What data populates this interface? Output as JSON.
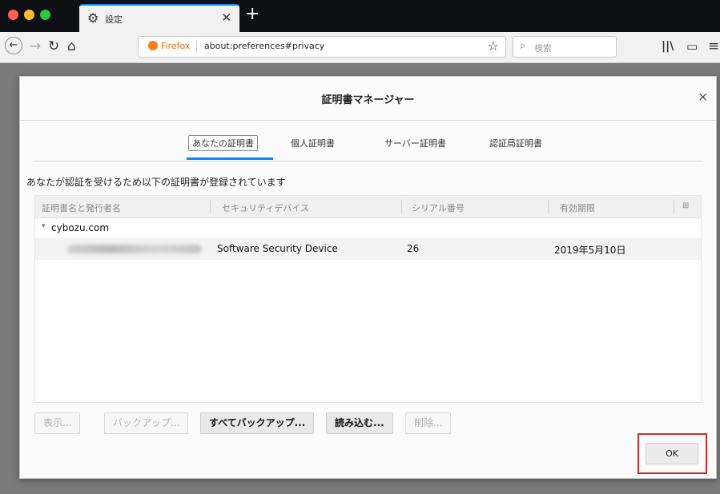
{
  "browser": {
    "tab_title": "設定",
    "url_brand": "Firefox",
    "url": "about:preferences#privacy",
    "search_placeholder": "検索",
    "traffic_colors": [
      "#fe5f57",
      "#febc2e",
      "#28c840"
    ]
  },
  "dialog": {
    "title": "証明書マネージャー",
    "tabs": [
      "あなたの証明書",
      "個人証明書",
      "サーバー証明書",
      "認証局証明書"
    ],
    "selected_tab": 0,
    "description": "あなたが認証を受けるため以下の証明書が登録されています",
    "columns": [
      "証明書名と発行者名",
      "セキュリティデバイス",
      "シリアル番号",
      "有効期限"
    ],
    "group": "cybozu.com",
    "row": {
      "device": "Software Security Device",
      "serial": "26",
      "expires": "2019年5月10日"
    },
    "buttons": {
      "view": "表示...",
      "backup": "バックアップ...",
      "backup_all": "すべてバックアップ...",
      "import": "読み込む...",
      "delete": "削除..."
    },
    "ok": "OK"
  }
}
